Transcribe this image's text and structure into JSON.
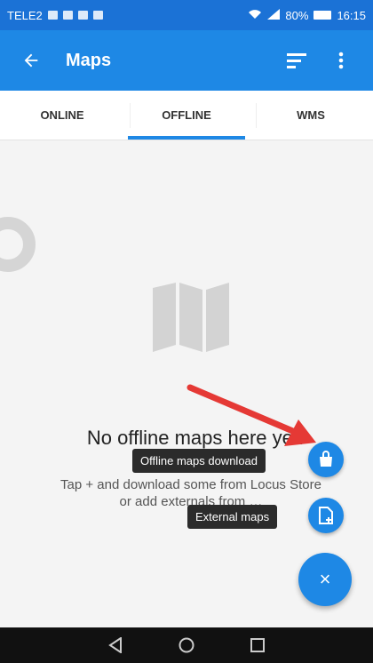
{
  "statusbar": {
    "carrier": "TELE2",
    "battery": "80%",
    "time": "16:15"
  },
  "appbar": {
    "title": "Maps",
    "back_icon": "arrow-back-icon",
    "sort_icon": "sort-icon",
    "more_icon": "more-vert-icon"
  },
  "tabs": [
    {
      "label": "ONLINE",
      "active": false
    },
    {
      "label": "OFFLINE",
      "active": true
    },
    {
      "label": "WMS",
      "active": false
    }
  ],
  "empty": {
    "title": "No offline maps here yet!",
    "line1": "Tap + and download some from Locus Store",
    "line2": "or add externals from …"
  },
  "fab_menu": {
    "download_label": "Offline maps download",
    "external_label": "External maps",
    "close_icon": "×"
  },
  "colors": {
    "primary": "#1e88e5",
    "statusbar": "#1b72d6",
    "arrow": "#e53935"
  }
}
